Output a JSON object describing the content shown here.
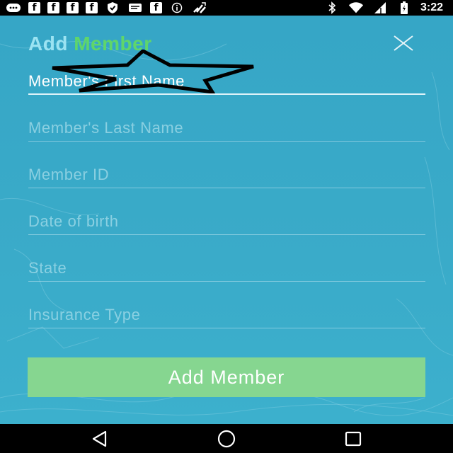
{
  "status_bar": {
    "time": "3:22",
    "notification_icons": [
      "messages-icon",
      "facebook-icon",
      "facebook-icon",
      "facebook-icon",
      "facebook-icon",
      "shield-icon",
      "email-icon",
      "facebook-icon",
      "info-icon",
      "satellite-icon"
    ],
    "system_icons": [
      "bluetooth-icon",
      "wifi-icon",
      "signal-icon",
      "battery-icon"
    ],
    "facebook_glyph": "f"
  },
  "header": {
    "title_part1": "Add",
    "title_part2": "Member",
    "title_part1_color": "#9be3f2",
    "title_part2_color": "#5fd66a"
  },
  "form": {
    "fields": [
      {
        "placeholder": "Member's First Name",
        "value": ""
      },
      {
        "placeholder": "Member's Last Name",
        "value": ""
      },
      {
        "placeholder": "Member ID",
        "value": ""
      },
      {
        "placeholder": "Date of birth",
        "value": ""
      },
      {
        "placeholder": "State",
        "value": ""
      },
      {
        "placeholder": "Insurance Type",
        "value": ""
      }
    ],
    "submit_label": "Add Member"
  },
  "colors": {
    "background": "#37a7c6",
    "button": "#86d690"
  },
  "nav_bar": {
    "buttons": [
      "back-icon",
      "home-icon",
      "recents-icon"
    ]
  }
}
